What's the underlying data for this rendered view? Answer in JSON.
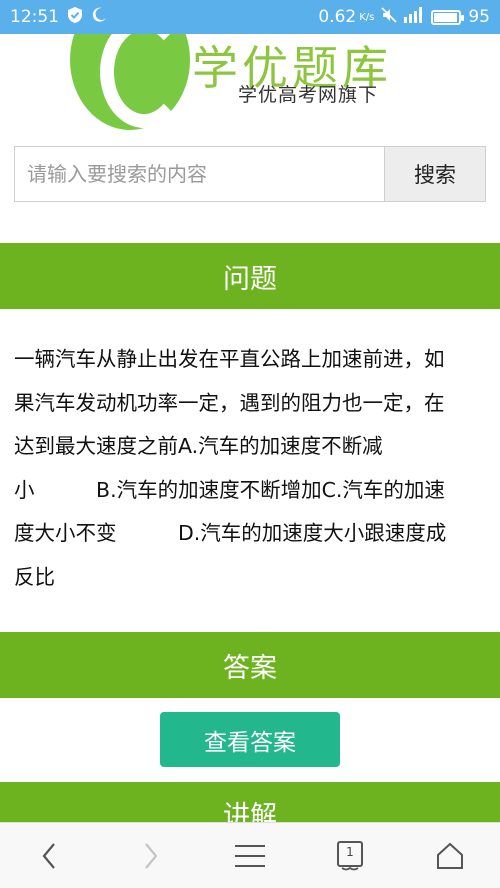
{
  "status_bar": {
    "time": "12:51",
    "network_speed": "0.62",
    "network_unit": "K/s",
    "battery_level": "95",
    "battery_fraction": 0.95
  },
  "header": {
    "logo_title": "学优题库",
    "logo_subtitle": "学优高考网旗下"
  },
  "search": {
    "placeholder": "请输入要搜索的内容",
    "button_label": "搜索"
  },
  "sections": {
    "question_title": "问题",
    "answer_title": "答案",
    "explain_title": "讲解"
  },
  "question": {
    "lines": [
      "一辆汽车从静止出发在平直公路上加速前进，如",
      "果汽车发动机功率一定，遇到的阻力也一定，在",
      "达到最大速度之前A.汽车的加速度不断减",
      "小　　　B.汽车的加速度不断增加C.汽车的加速",
      "度大小不变　　　D.汽车的加速度大小跟速度成",
      "反比"
    ]
  },
  "answer": {
    "button_label": "查看答案"
  },
  "bottom_nav": {
    "tab_count": "1",
    "icons": [
      "back-icon",
      "forward-icon",
      "menu-icon",
      "tabs-icon",
      "home-icon"
    ]
  },
  "colors": {
    "status_bar": "#5ab0ea",
    "section_green": "#6cb31f",
    "answer_button": "#22b78c",
    "logo_green": "#7ac943"
  }
}
